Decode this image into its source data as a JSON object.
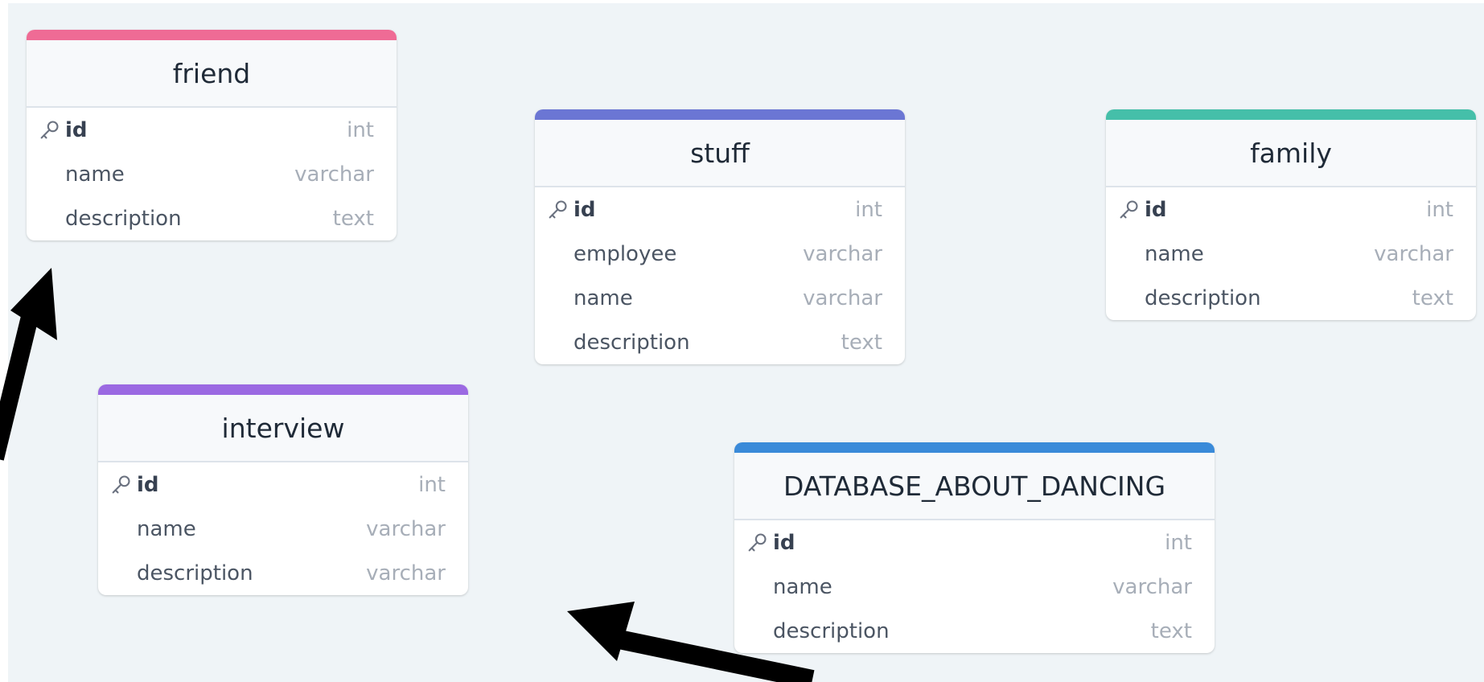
{
  "tables": [
    {
      "name": "friend",
      "color": "#ef6b95",
      "fields": [
        {
          "name": "id",
          "type": "int",
          "pk": true
        },
        {
          "name": "name",
          "type": "varchar"
        },
        {
          "name": "description",
          "type": "text"
        }
      ]
    },
    {
      "name": "stuff",
      "color": "#6b76d4",
      "fields": [
        {
          "name": "id",
          "type": "int",
          "pk": true
        },
        {
          "name": "employee",
          "type": "varchar"
        },
        {
          "name": "name",
          "type": "varchar"
        },
        {
          "name": "description",
          "type": "text"
        }
      ]
    },
    {
      "name": "family",
      "color": "#45bfa9",
      "fields": [
        {
          "name": "id",
          "type": "int",
          "pk": true
        },
        {
          "name": "name",
          "type": "varchar"
        },
        {
          "name": "description",
          "type": "text"
        }
      ]
    },
    {
      "name": "interview",
      "color": "#9b69e2",
      "fields": [
        {
          "name": "id",
          "type": "int",
          "pk": true
        },
        {
          "name": "name",
          "type": "varchar"
        },
        {
          "name": "description",
          "type": "varchar"
        }
      ]
    },
    {
      "name": "DATABASE_ABOUT_DANCING",
      "color": "#3a8ad9",
      "fields": [
        {
          "name": "id",
          "type": "int",
          "pk": true
        },
        {
          "name": "name",
          "type": "varchar"
        },
        {
          "name": "description",
          "type": "text"
        }
      ]
    }
  ],
  "arrows": [
    {
      "name": "annotation-arrow-to-friend",
      "points_to": "friend"
    },
    {
      "name": "annotation-arrow-to-interview-area",
      "points_to": "canvas"
    }
  ],
  "key_icon": "key-icon"
}
